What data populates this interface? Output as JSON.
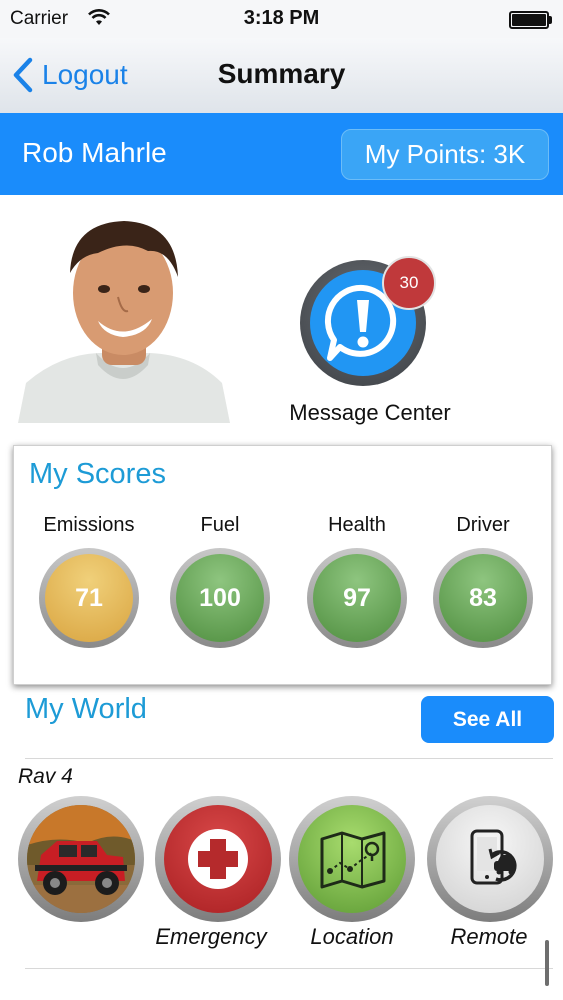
{
  "status": {
    "carrier": "Carrier",
    "time": "3:18 PM"
  },
  "nav": {
    "back_label": "Logout",
    "title": "Summary"
  },
  "user": {
    "name": "Rob Mahrle",
    "points_label": "My Points: 3K"
  },
  "message_center": {
    "label": "Message Center",
    "badge_count": "30"
  },
  "scores": {
    "title": "My Scores",
    "items": [
      {
        "label": "Emissions",
        "value": "71",
        "color": "#e0b452"
      },
      {
        "label": "Fuel",
        "value": "100",
        "color": "#5f9e4f"
      },
      {
        "label": "Health",
        "value": "97",
        "color": "#5f9e4f"
      },
      {
        "label": "Driver",
        "value": "83",
        "color": "#5f9e4f"
      }
    ]
  },
  "world": {
    "title": "My World",
    "see_all_label": "See All",
    "vehicle_name": "Rav 4",
    "items": [
      {
        "label": "",
        "icon": "vehicle-photo-icon"
      },
      {
        "label": "Emergency",
        "icon": "red-cross-icon"
      },
      {
        "label": "Location",
        "icon": "map-icon"
      },
      {
        "label": "Remote",
        "icon": "phone-car-remote-icon"
      }
    ]
  },
  "colors": {
    "accent": "#1a8cfb",
    "title_blue": "#1d9bd6",
    "badge_red": "#c0393b"
  }
}
